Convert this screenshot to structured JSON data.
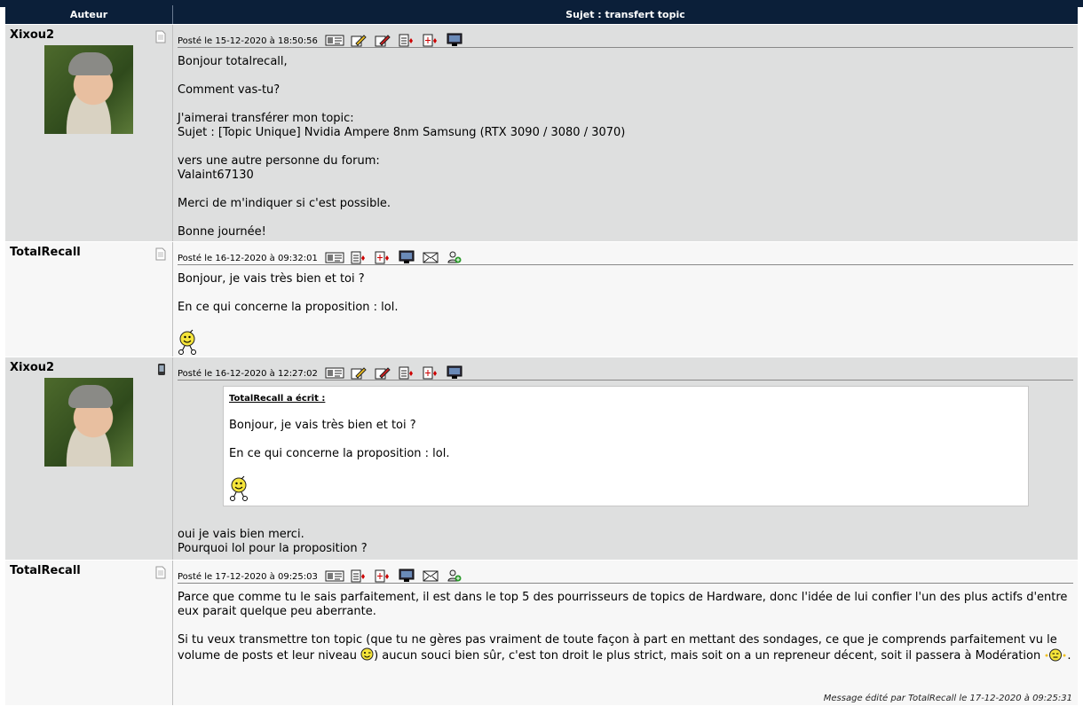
{
  "header": {
    "author_col": "Auteur",
    "subject_col": "Sujet : transfert topic"
  },
  "posts": [
    {
      "author": "Xixou2",
      "meta": "Posté le 15-12-2020 à 18:50:56",
      "status_icon": "document-icon",
      "lines": [
        "Bonjour totalrecall,",
        "Comment vas-tu?",
        "J'aimerai transférer mon topic:",
        "Sujet : [Topic Unique] Nvidia Ampere 8nm Samsung (RTX 3090 / 3080 / 3070)",
        "vers une autre personne du forum:",
        "Valaint67130",
        "Merci de m'indiquer si c'est possible.",
        "Bonne journée!"
      ]
    },
    {
      "author": "TotalRecall",
      "meta": "Posté le 16-12-2020 à 09:32:01",
      "status_icon": "document-icon",
      "lines": [
        "Bonjour, je vais très bien et toi ?",
        "En ce qui concerne la proposition : lol."
      ]
    },
    {
      "author": "Xixou2",
      "meta": "Posté le 16-12-2020 à 12:27:02",
      "status_icon": "mobile-phone-icon",
      "quote": {
        "header": "TotalRecall a écrit :",
        "line1": "Bonjour, je vais très bien et toi ?",
        "line2": "En ce qui concerne la proposition : lol."
      },
      "lines": [
        "oui je vais bien merci.",
        "Pourquoi lol pour la proposition ?"
      ]
    },
    {
      "author": "TotalRecall",
      "meta": "Posté le 17-12-2020 à 09:25:03",
      "status_icon": "document-icon",
      "paragraph1": "Parce que comme tu le sais parfaitement, il est dans le top 5 des pourrisseurs de topics de Hardware, donc l'idée de lui confier l'un des plus actifs d'entre eux parait quelque peu aberrante.",
      "paragraph2a": "Si tu veux transmettre ton topic (que tu ne gères pas vraiment de toute façon à part en mettant des sondages, ce que je comprends parfaitement vu le volume de posts et leur niveau ",
      "paragraph2b": ") aucun souci bien sûr, c'est ton droit le plus strict, mais soit on a un repreneur décent, soit il passera à Modération ",
      "paragraph2c": ".",
      "edited": "Message édité par TotalRecall le 17-12-2020 à 09:25:31"
    }
  ]
}
